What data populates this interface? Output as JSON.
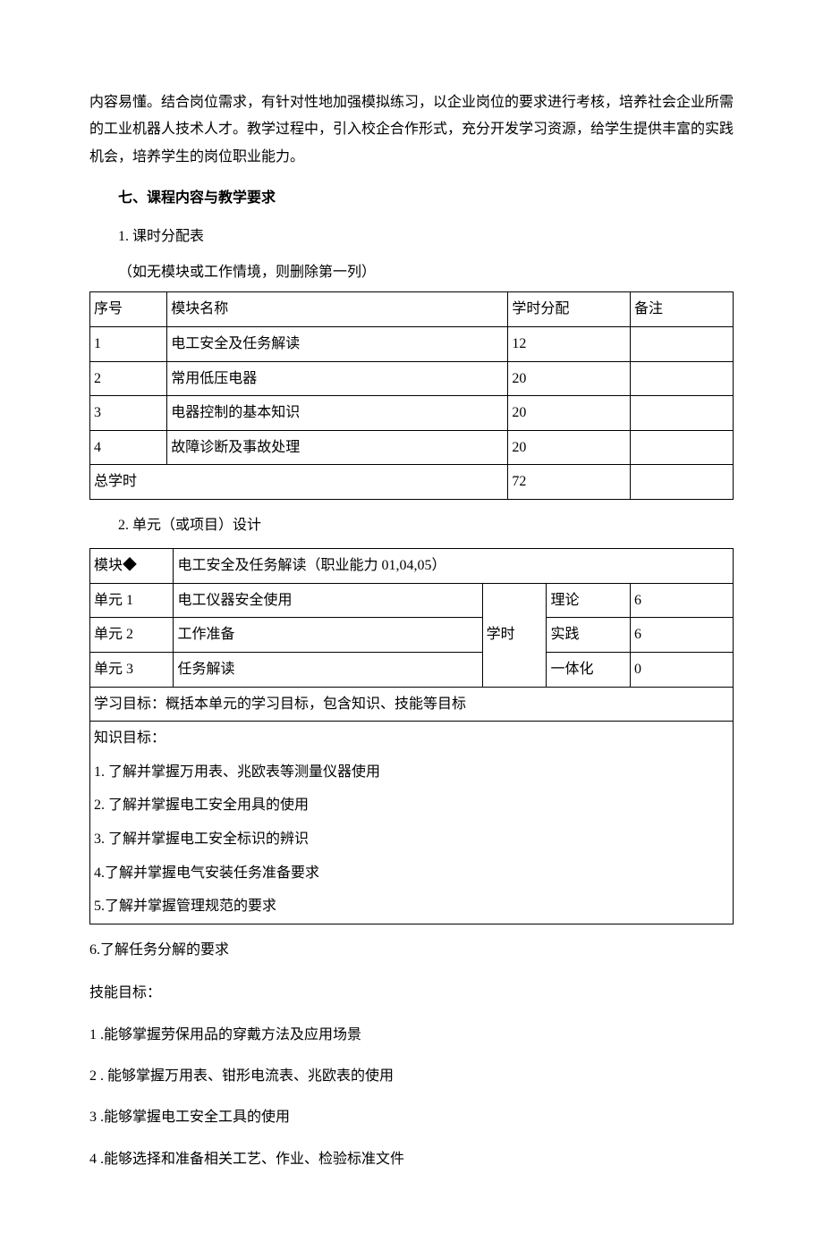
{
  "intro_paragraph": "内容易懂。结合岗位需求，有针对性地加强模拟练习，以企业岗位的要求进行考核，培养社会企业所需的工业机器人技术人才。教学过程中，引入校企合作形式，充分开发学习资源，给学生提供丰富的实践机会，培养学生的岗位职业能力。",
  "section7_heading": "七、课程内容与教学要求",
  "sub1_heading": "1. 课时分配表",
  "sub1_note": "（如无模块或工作情境，则删除第一列）",
  "table1": {
    "headers": {
      "seq": "序号",
      "name": "模块名称",
      "hours": "学时分配",
      "remark": "备注"
    },
    "rows": [
      {
        "seq": "1",
        "name": "电工安全及任务解读",
        "hours": "12",
        "remark": ""
      },
      {
        "seq": "2",
        "name": "常用低压电器",
        "hours": "20",
        "remark": ""
      },
      {
        "seq": "3",
        "name": "电器控制的基本知识",
        "hours": "20",
        "remark": ""
      },
      {
        "seq": "4",
        "name": "故障诊断及事故处理",
        "hours": "20",
        "remark": ""
      }
    ],
    "total_label": "总学时",
    "total_hours": "72"
  },
  "sub2_heading": "2. 单元（或项目）设计",
  "table2": {
    "module_label": "模块◆",
    "module_value": "电工安全及任务解读（职业能力 01,04,05）",
    "unit1_label": "单元 1",
    "unit1_value": "电工仪器安全使用",
    "unit2_label": "单元 2",
    "unit2_value": "工作准备",
    "unit3_label": "单元 3",
    "unit3_value": "任务解读",
    "hours_label": "学时",
    "theory_label": "理论",
    "theory_hours": "6",
    "practice_label": "实践",
    "practice_hours": "6",
    "integrated_label": "一体化",
    "integrated_hours": "0",
    "goal_line": "学习目标：概括本单元的学习目标，包含知识、技能等目标",
    "knowledge_heading": "知识目标：",
    "k1": "1. 了解并掌握万用表、兆欧表等测量仪器使用",
    "k2": "2. 了解并掌握电工安全用具的使用",
    "k3": "3. 了解并掌握电工安全标识的辨识",
    "k4": "4.了解并掌握电气安装任务准备要求",
    "k5": "5.了解并掌握管理规范的要求"
  },
  "after_table2_line": "6.了解任务分解的要求",
  "skill_heading": "技能目标：",
  "s1": "1 .能够掌握劳保用品的穿戴方法及应用场景",
  "s2": "2  . 能够掌握万用表、钳形电流表、兆欧表的使用",
  "s3": "3  .能够掌握电工安全工具的使用",
  "s4": "4  .能够选择和准备相关工艺、作业、检验标准文件"
}
